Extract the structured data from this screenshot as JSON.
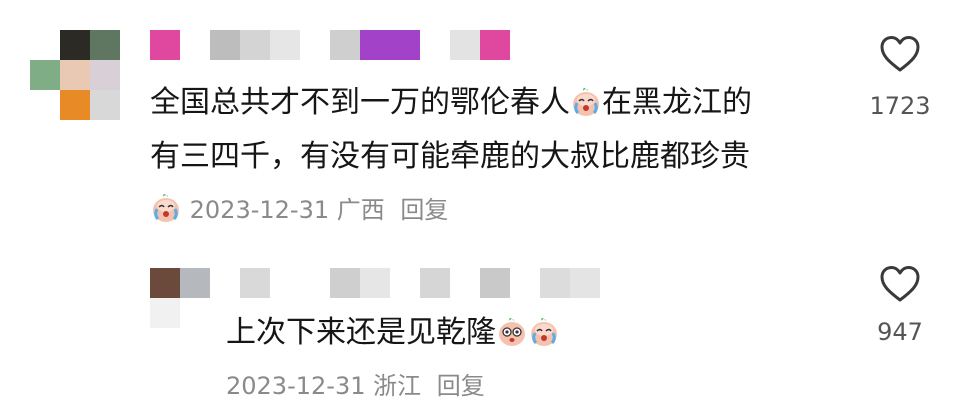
{
  "comments": [
    {
      "text_part1": "全国总共才不到一万的鄂伦春人",
      "text_part2": "在黑龙江的",
      "text_line2": "有三四千，有没有可能牵鹿的大叔比鹿都珍贵",
      "date": "2023-12-31",
      "location": "广西",
      "reply_label": "回复",
      "likes": "1723"
    },
    {
      "text": "上次下来还是见乾隆",
      "date": "2023-12-31",
      "location": "浙江",
      "reply_label": "回复",
      "likes": "947"
    }
  ],
  "icons": {
    "like": "heart-outline-icon",
    "emoji": "crying-peach-emoji-icon"
  },
  "colors": {
    "text": "#161616",
    "meta": "#8a8a8a",
    "pink": "#e0479e",
    "purple": "#a142c9",
    "gray_block": "#c8c8c8"
  }
}
